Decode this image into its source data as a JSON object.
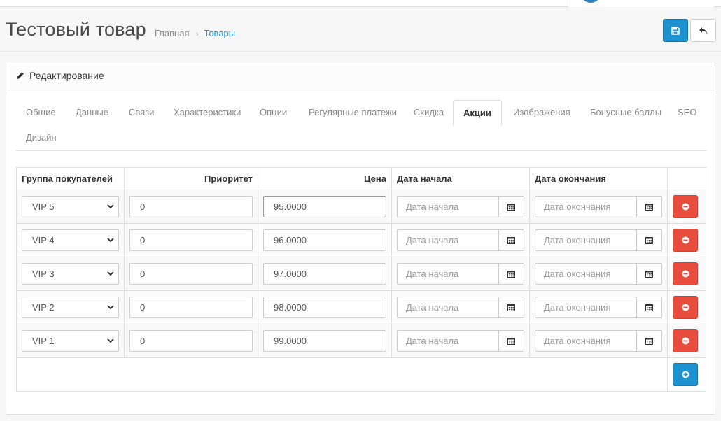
{
  "page": {
    "title": "Тестовый товар",
    "breadcrumb": [
      {
        "label": "Главная"
      },
      {
        "label": "Товары"
      }
    ],
    "breadcrumb_separator": "›"
  },
  "actions": {
    "save_icon": "save-icon",
    "back_icon": "reply-icon"
  },
  "panel": {
    "heading": "Редактирование",
    "heading_icon": "pencil-icon"
  },
  "tabs": [
    {
      "label": "Общие",
      "active": false
    },
    {
      "label": "Данные",
      "active": false
    },
    {
      "label": "Связи",
      "active": false
    },
    {
      "label": "Характеристики",
      "active": false
    },
    {
      "label": "Опции",
      "active": false
    },
    {
      "label": "Регулярные платежи",
      "active": false
    },
    {
      "label": "Скидка",
      "active": false
    },
    {
      "label": "Акции",
      "active": true
    },
    {
      "label": "Изображения",
      "active": false
    },
    {
      "label": "Бонусные баллы",
      "active": false
    },
    {
      "label": "SEO",
      "active": false
    },
    {
      "label": "Дизайн",
      "active": false
    }
  ],
  "table": {
    "headers": {
      "group": "Группа покупателей",
      "priority": "Приоритет",
      "price": "Цена",
      "date_start": "Дата начала",
      "date_end": "Дата окончания"
    },
    "rows": [
      {
        "group": "VIP 5",
        "priority": "0",
        "price": "95.0000",
        "date_start_placeholder": "Дата начала",
        "date_end_placeholder": "Дата окончания"
      },
      {
        "group": "VIP 4",
        "priority": "0",
        "price": "96.0000",
        "date_start_placeholder": "Дата начала",
        "date_end_placeholder": "Дата окончания"
      },
      {
        "group": "VIP 3",
        "priority": "0",
        "price": "97.0000",
        "date_start_placeholder": "Дата начала",
        "date_end_placeholder": "Дата окончания"
      },
      {
        "group": "VIP 2",
        "priority": "0",
        "price": "98.0000",
        "date_start_placeholder": "Дата начала",
        "date_end_placeholder": "Дата окончания"
      },
      {
        "group": "VIP 1",
        "priority": "0",
        "price": "99.0000",
        "date_start_placeholder": "Дата начала",
        "date_end_placeholder": "Дата окончания"
      }
    ]
  },
  "colors": {
    "primary": "#1e91cf",
    "danger": "#e74c3c",
    "link": "#1e91cf"
  }
}
